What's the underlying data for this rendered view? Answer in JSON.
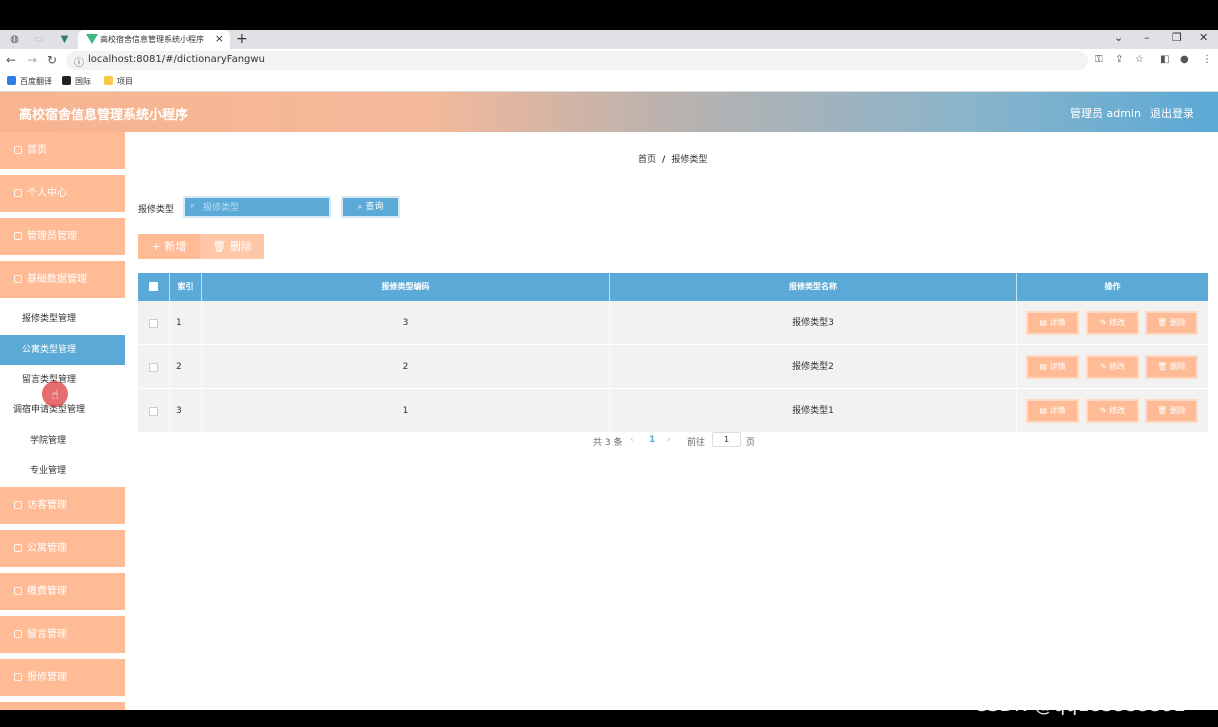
{
  "browser": {
    "tab_title": "高校宿舍信息管理系统小程序",
    "url": "localhost:8081/#/dictionaryFangwu",
    "bookmarks": [
      "百度翻译",
      "国际",
      "项目"
    ]
  },
  "header": {
    "title": "高校宿舍信息管理系统小程序",
    "user": "管理员 admin",
    "logout": "退出登录"
  },
  "sidebar": {
    "main_items": [
      "首页",
      "个人中心",
      "管理员管理",
      "基础数据管理"
    ],
    "sub_items": [
      "报修类型管理",
      "公寓类型管理",
      "留言类型管理",
      "调宿申请类型管理",
      "学院管理",
      "专业管理"
    ],
    "bottom_items": [
      "访客管理",
      "公寓管理",
      "缴费管理",
      "留言管理",
      "报修管理"
    ],
    "active_sub": "公寓类型管理"
  },
  "breadcrumb": {
    "home": "首页",
    "sep": "/",
    "current": "报修类型"
  },
  "search": {
    "label": "报修类型",
    "placeholder": "报修类型",
    "button": "查询"
  },
  "actions": {
    "add": "+ 新增",
    "delete": "删除"
  },
  "table": {
    "headers": [
      "索引",
      "报修类型编码",
      "报修类型名称",
      "操作"
    ],
    "rows": [
      {
        "index": "1",
        "code": "3",
        "name": "报修类型3"
      },
      {
        "index": "2",
        "code": "2",
        "name": "报修类型2"
      },
      {
        "index": "3",
        "code": "1",
        "name": "报修类型1"
      }
    ],
    "row_actions": {
      "detail": "详情",
      "edit": "修改",
      "delete": "删除"
    }
  },
  "pagination": {
    "total": "共 3 条",
    "current": "1",
    "goto": "前往",
    "goto_value": "1",
    "page_unit": "页"
  },
  "watermark": "CSDN @qq183535392",
  "colors": {
    "accent_blue": "#5aa9d6",
    "accent_peach": "#ffbb96"
  }
}
